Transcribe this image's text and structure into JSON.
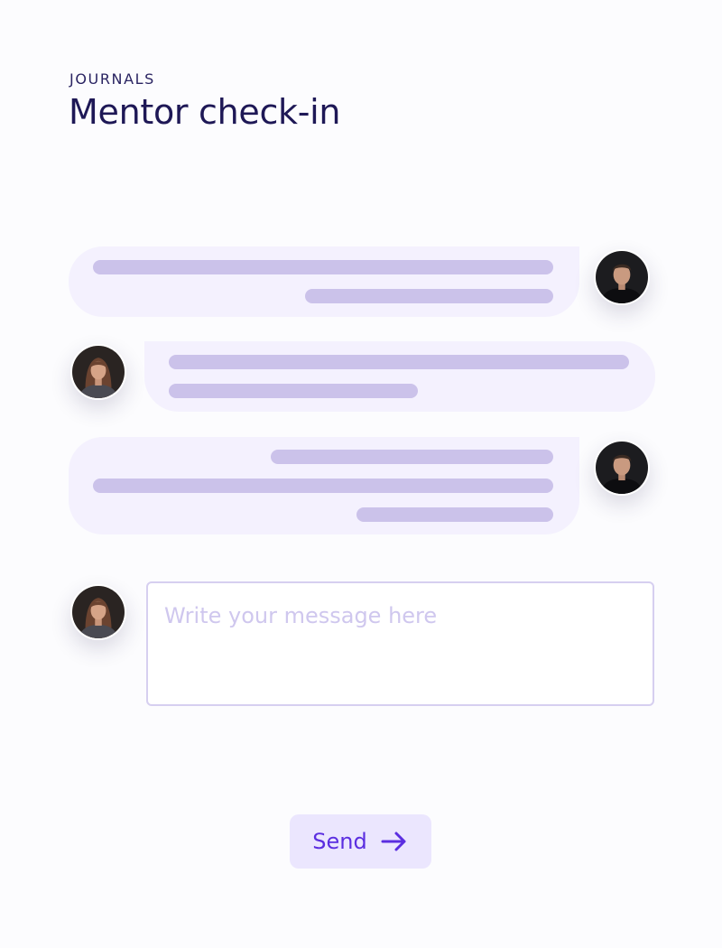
{
  "header": {
    "section_label": "JOURNALS",
    "title": "Mentor check-in"
  },
  "conversation": {
    "messages": [
      {
        "sender": "mentor",
        "side": "right",
        "avatar_icon": "man-avatar-icon"
      },
      {
        "sender": "mentee",
        "side": "left",
        "avatar_icon": "woman-avatar-icon"
      },
      {
        "sender": "mentor",
        "side": "right",
        "avatar_icon": "man-avatar-icon"
      }
    ]
  },
  "composer": {
    "placeholder": "Write your message here",
    "value": "",
    "avatar_icon": "woman-avatar-icon"
  },
  "actions": {
    "send_label": "Send",
    "send_icon": "arrow-right-icon"
  },
  "colors": {
    "accent": "#5b2ee0",
    "title": "#1e1856",
    "bubble": "#f4f1fe",
    "text_placeholder_line": "#cbc2ea",
    "send_button_bg": "#ebe6fe"
  }
}
